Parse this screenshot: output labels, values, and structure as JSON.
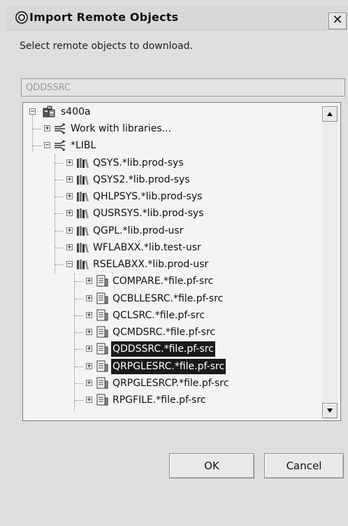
{
  "window": {
    "title": "Import Remote Objects",
    "close_glyph": "✕"
  },
  "instruction": "Select remote objects to download.",
  "filter": {
    "value": "QDDSSRC"
  },
  "tree": {
    "root": "s400a",
    "nodes": [
      {
        "label": "Work with libraries...",
        "expander": "+",
        "icon": "filter-icon"
      },
      {
        "label": "*LIBL",
        "expander": "−",
        "icon": "filter-icon"
      },
      {
        "label": "QSYS.*lib.prod-sys",
        "expander": "+",
        "icon": "library-icon"
      },
      {
        "label": "QSYS2.*lib.prod-sys",
        "expander": "+",
        "icon": "library-icon"
      },
      {
        "label": "QHLPSYS.*lib.prod-sys",
        "expander": "+",
        "icon": "library-icon"
      },
      {
        "label": "QUSRSYS.*lib.prod-sys",
        "expander": "+",
        "icon": "library-icon"
      },
      {
        "label": "QGPL.*lib.prod-usr",
        "expander": "+",
        "icon": "library-icon"
      },
      {
        "label": "WFLABXX.*lib.test-usr",
        "expander": "+",
        "icon": "library-icon"
      },
      {
        "label": "RSELABXX.*lib.prod-usr",
        "expander": "−",
        "icon": "library-icon"
      },
      {
        "label": "COMPARE.*file.pf-src",
        "expander": "+",
        "icon": "file-icon"
      },
      {
        "label": "QCBLLESRC.*file.pf-src",
        "expander": "+",
        "icon": "file-icon"
      },
      {
        "label": "QCLSRC.*file.pf-src",
        "expander": "+",
        "icon": "file-icon"
      },
      {
        "label": "QCMDSRC.*file.pf-src",
        "expander": "+",
        "icon": "file-icon"
      },
      {
        "label": "QDDSSRC.*file.pf-src",
        "expander": "+",
        "icon": "file-icon",
        "selected": true
      },
      {
        "label": "QRPGLESRC.*file.pf-src",
        "expander": "+",
        "icon": "file-icon",
        "selected": true
      },
      {
        "label": "QRPGLESRCP.*file.pf-src",
        "expander": "+",
        "icon": "file-icon"
      },
      {
        "label": "RPGFILE.*file.pf-src",
        "expander": "+",
        "icon": "file-icon"
      }
    ]
  },
  "buttons": {
    "ok": "OK",
    "cancel": "Cancel"
  }
}
